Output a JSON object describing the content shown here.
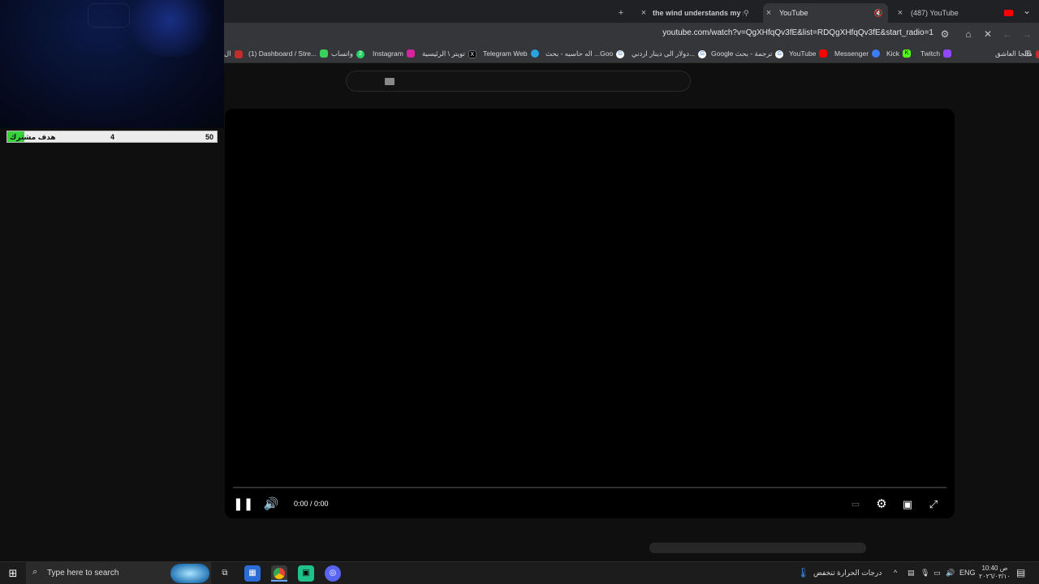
{
  "browser": {
    "tabs": [
      {
        "title": "the wind understands my sil..."
      },
      {
        "title": "YouTube"
      },
      {
        "title": "(487) YouTube"
      }
    ],
    "new_tab": "+",
    "url": "youtube.com/watch?v=QgXHfqQv3fE&list=RDQgXHfqQv3fE&start_radio=1",
    "bookmarks": [
      {
        "label": "مانجا العاشق",
        "icon": "red"
      },
      {
        "label": "Twitch",
        "icon": "purple"
      },
      {
        "label": "Kick",
        "icon": "green"
      },
      {
        "label": "Messenger",
        "icon": "blue"
      },
      {
        "label": "YouTube",
        "icon": "red"
      },
      {
        "label": "Google ترجمة - بحث",
        "icon": "google"
      },
      {
        "label": "دولار الى دينار اردني...",
        "icon": "google"
      },
      {
        "label": "اله حاسبه - بحث ...Goo",
        "icon": "google"
      },
      {
        "label": "Telegram Web",
        "icon": "blue"
      },
      {
        "label": "تويتر \\ الرئيسية",
        "icon": "black"
      },
      {
        "label": "Instagram",
        "icon": "pink"
      },
      {
        "label": "واتساب",
        "icon": "green"
      },
      {
        "label": "(1) Dashboard / Stre...",
        "icon": "green"
      },
      {
        "label": "ال",
        "icon": "red"
      }
    ]
  },
  "overlay": {
    "goal_label": "هدف مشترك",
    "goal_current": "4",
    "goal_target": "50",
    "goal_fraction": 0.08
  },
  "player": {
    "time": "0:00 / 0:00",
    "state": "playing"
  },
  "taskbar": {
    "search_placeholder": "Type here to search",
    "weather": "درجات الحرارة تنخفض",
    "language": "ENG",
    "clock_time": "10:40 ص",
    "clock_date": "٢٠٢٦/٠٣/١٠"
  },
  "colors": {
    "goal_fill": "#3bd13b",
    "youtube_red": "#ff0000"
  }
}
